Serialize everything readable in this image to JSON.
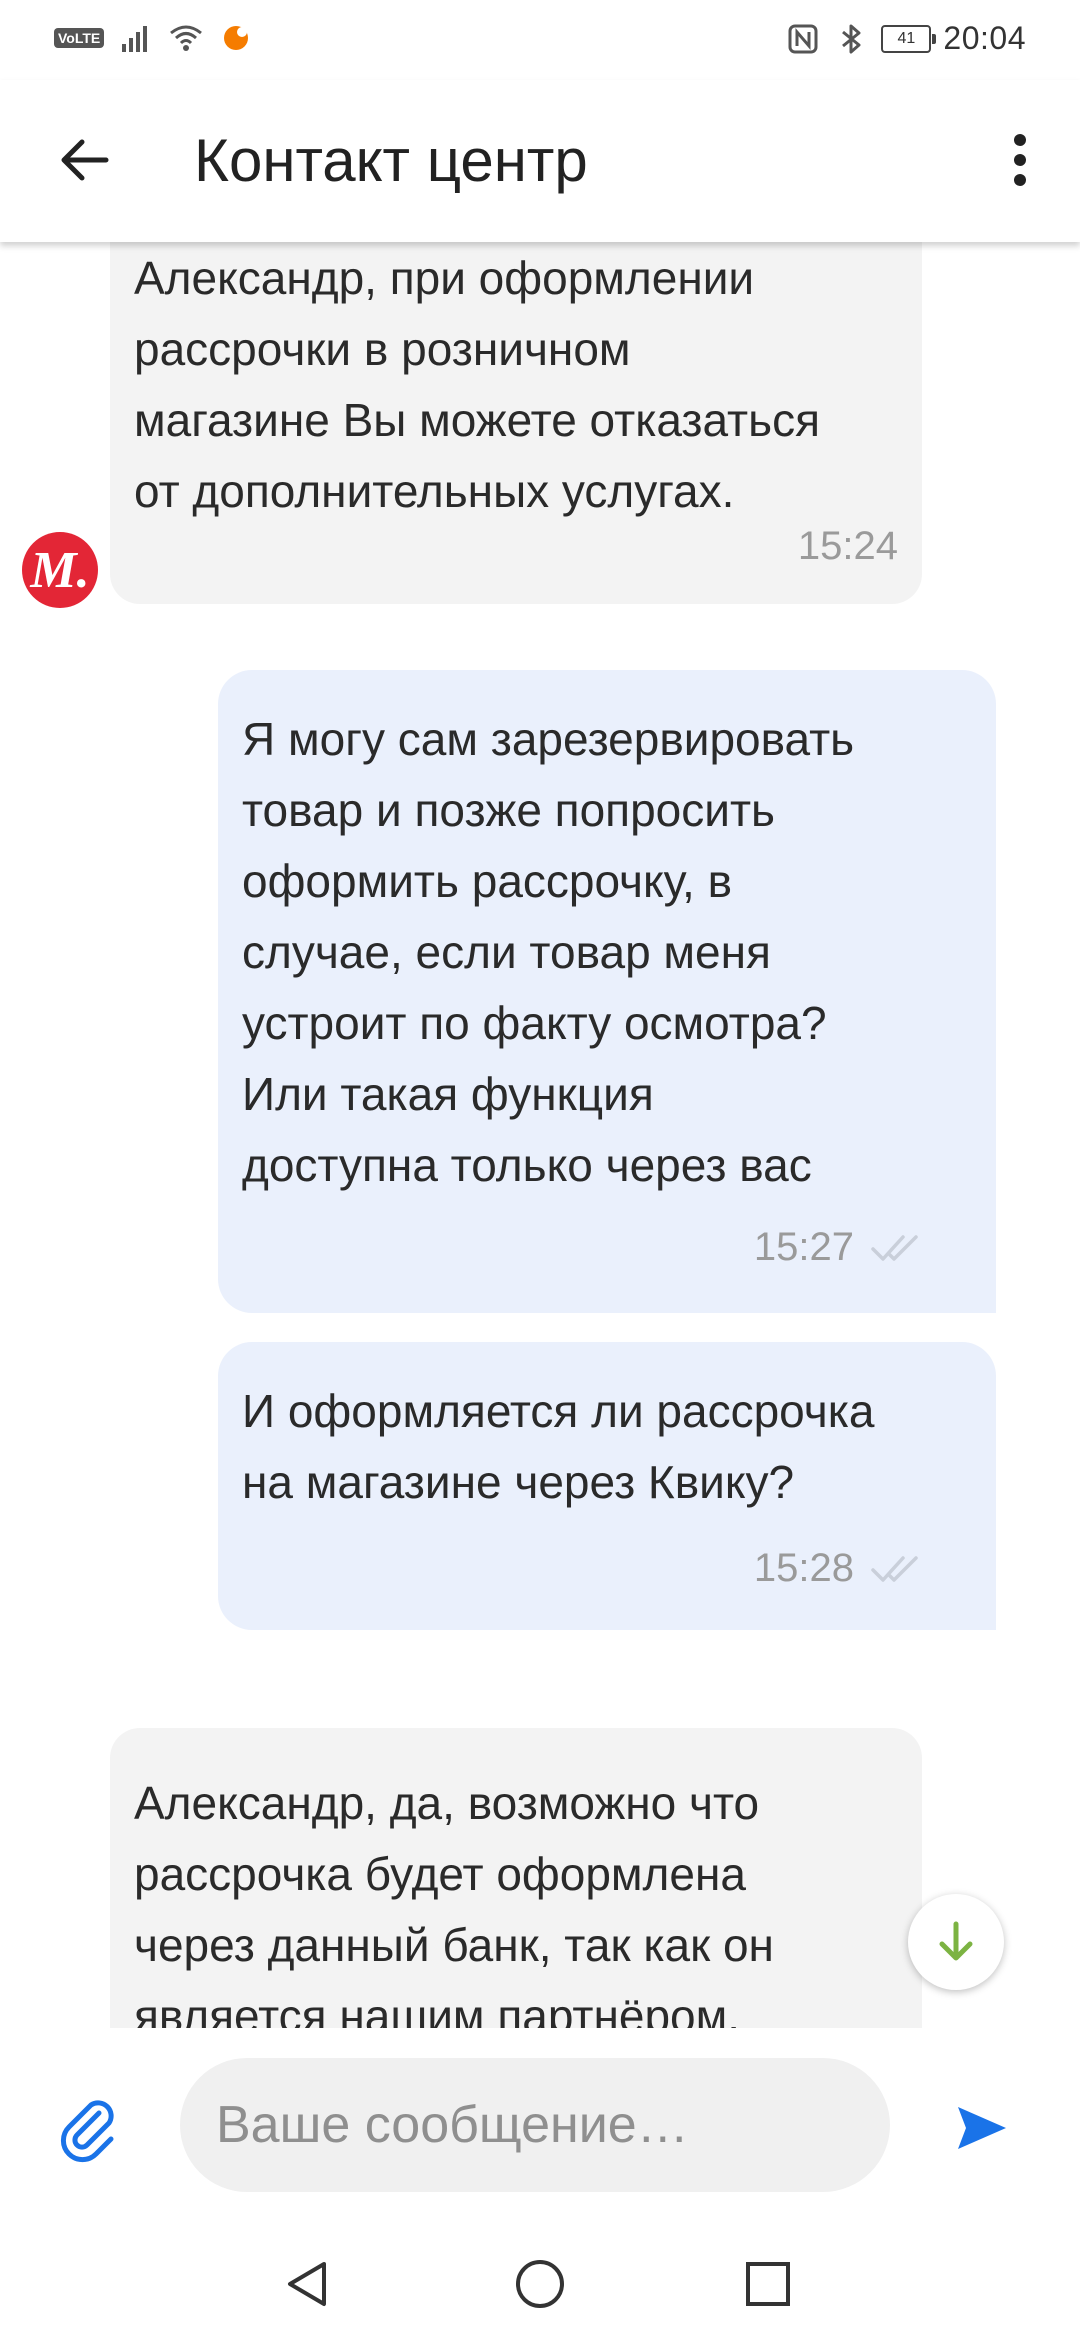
{
  "status_bar": {
    "volte": "VoLTE",
    "battery_level": "41",
    "time": "20:04"
  },
  "header": {
    "title": "Контакт центр",
    "back_icon": "arrow-left-icon",
    "menu_icon": "more-vertical-icon"
  },
  "messages": [
    {
      "direction": "incoming",
      "text": "Александр, при оформлении\nрассрочки в розничном\nмагазине Вы можете отказаться\nот дополнительных услугах.",
      "time": "15:24"
    },
    {
      "direction": "outgoing",
      "text": "Я могу сам зарезервировать\nтовар и позже попросить\nоформить рассрочку, в\nслучае, если товар меня\nустроит по факту осмотра?\nИли такая функция\nдоступна только через вас",
      "time": "15:27",
      "read": true
    },
    {
      "direction": "outgoing",
      "text": "И оформляется ли рассрочка\nна магазине через Квику?",
      "time": "15:28",
      "read": true
    },
    {
      "direction": "incoming",
      "text": "Александр, да, возможно что\nрассрочка будет оформлена\nчерез данный банк, так как он\nявляется нашим партнёром.",
      "time": ""
    }
  ],
  "avatar": {
    "letter": "М."
  },
  "composer": {
    "placeholder": "Ваше сообщение…",
    "value": ""
  },
  "colors": {
    "accent": "#1a73e8",
    "scroll_arrow": "#7cb342",
    "avatar_bg": "#e32636",
    "incoming_bubble": "#f3f3f3",
    "outgoing_bubble": "#eaf0fc"
  }
}
